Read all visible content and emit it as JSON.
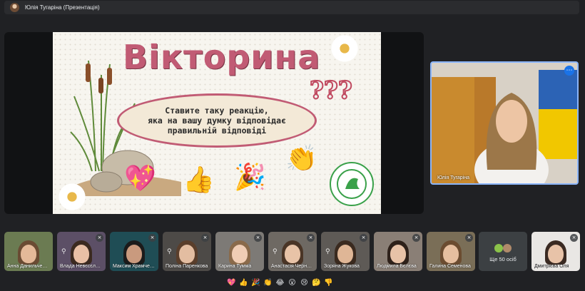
{
  "topbar": {
    "presenter_title": "Юлія Тугаріна (Презентація)"
  },
  "slide": {
    "title": "Вікторина",
    "text_line1": "Ставите таку реакцію,",
    "text_line2": "яка на вашу думку відповідає",
    "text_line3": "правильній відповіді",
    "question_marks": "???"
  },
  "presenter_tile": {
    "name": "Юлія Тугаріна",
    "accent": "#8ab4f8"
  },
  "participants": [
    {
      "name": "Анна Данильченко"
    },
    {
      "name": "Влада Невєсєлова"
    },
    {
      "name": "Максим Храмченко"
    },
    {
      "name": "Поліна Паренкова"
    },
    {
      "name": "Карина Тумма"
    },
    {
      "name": "Анастасія Чернова"
    },
    {
      "name": "Зоряна Жукова"
    },
    {
      "name": "Людмила Бєлєва"
    },
    {
      "name": "Галина Семенова"
    }
  ],
  "more_people": {
    "label": "Ще 50 осіб"
  },
  "last_participant": {
    "name": "Дмитрієва Оля"
  },
  "reactions": [
    "💖",
    "👍",
    "🎉",
    "👏",
    "😂",
    "😮",
    "😢",
    "🤔",
    "👎"
  ],
  "icons": {
    "mic_off": "mic-off-icon",
    "pin": "pin-icon",
    "more": "more-options-icon"
  }
}
